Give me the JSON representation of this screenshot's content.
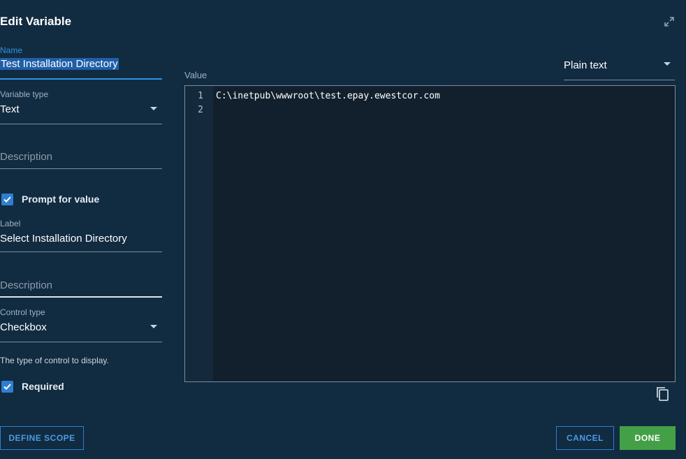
{
  "dialog": {
    "title": "Edit Variable",
    "expand_icon": "expand-icon"
  },
  "form": {
    "name": {
      "label": "Name",
      "value": "Test Installation Directory"
    },
    "variable_type": {
      "label": "Variable type",
      "value": "Text"
    },
    "description": {
      "placeholder": "Description"
    },
    "prompt_for_value": {
      "label": "Prompt for value",
      "checked": true
    },
    "prompt_label": {
      "label": "Label",
      "value": "Select Installation Directory"
    },
    "prompt_description": {
      "placeholder": "Description"
    },
    "control_type": {
      "label": "Control type",
      "value": "Checkbox",
      "helper": "The type of control to display."
    },
    "required": {
      "label": "Required",
      "checked": true
    }
  },
  "value_panel": {
    "label": "Value",
    "mode": "Plain text",
    "lines": [
      {
        "num": "1",
        "text": "C:\\inetpub\\wwwroot\\test.epay.ewestcor.com"
      },
      {
        "num": "2",
        "text": ""
      }
    ],
    "copy_icon": "copy-icon"
  },
  "buttons": {
    "define_scope": "DEFINE SCOPE",
    "cancel": "CANCEL",
    "done": "DONE"
  },
  "colors": {
    "background": "#112b41",
    "accent": "#2f93e0",
    "done": "#44a047"
  }
}
